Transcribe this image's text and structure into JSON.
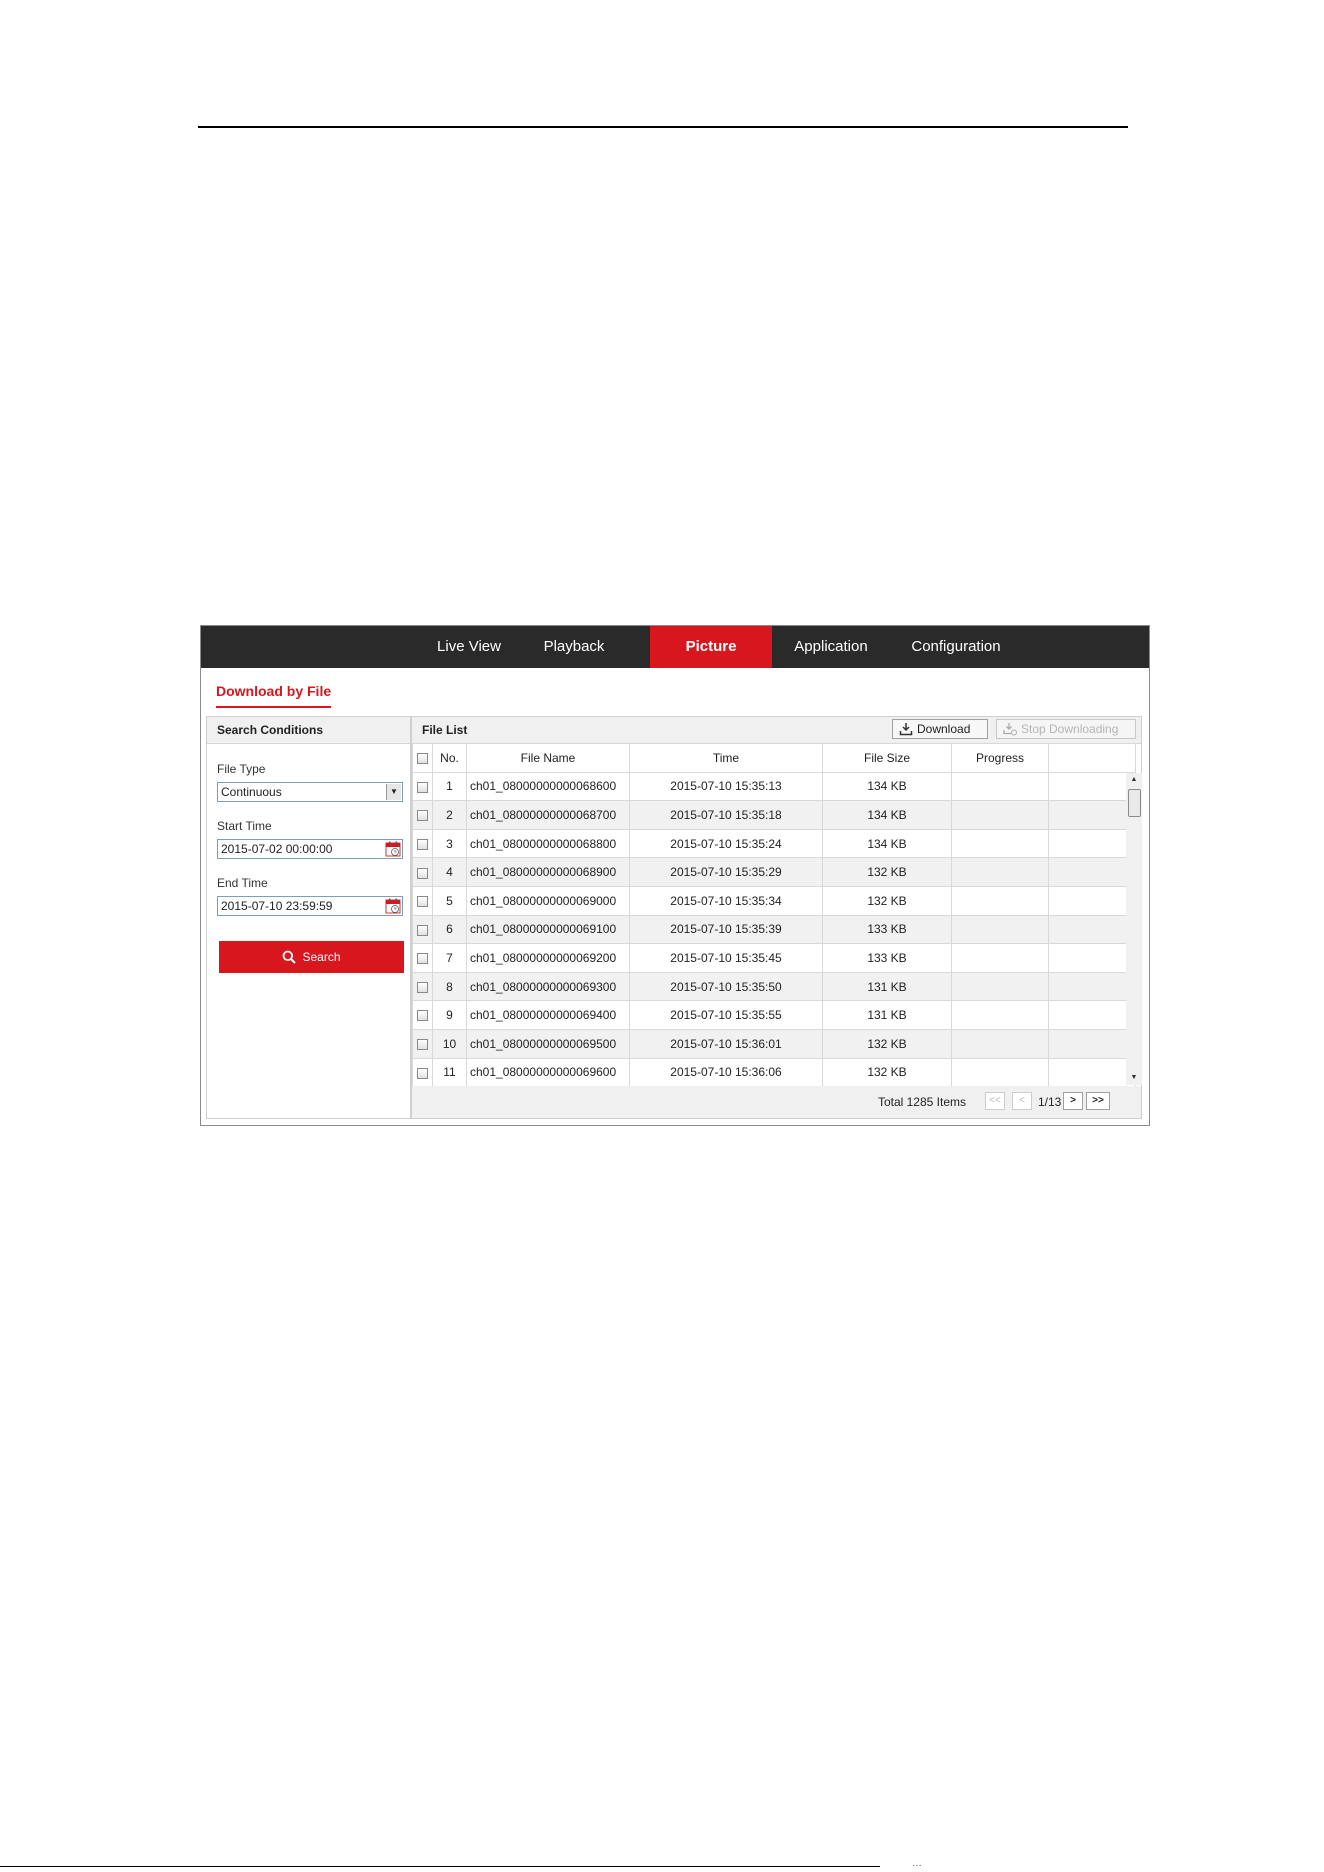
{
  "nav": {
    "tabs": [
      {
        "label": "Live View",
        "active": false
      },
      {
        "label": "Playback",
        "active": false
      },
      {
        "label": "Picture",
        "active": true
      },
      {
        "label": "Application",
        "active": false
      },
      {
        "label": "Configuration",
        "active": false
      }
    ],
    "accent_color": "#d7161e"
  },
  "subtab": {
    "label": "Download by File"
  },
  "search": {
    "title": "Search Conditions",
    "file_type_label": "File Type",
    "file_type_value": "Continuous",
    "start_label": "Start Time",
    "start_value": "2015-07-02 00:00:00",
    "end_label": "End Time",
    "end_value": "2015-07-10 23:59:59",
    "button_label": "Search"
  },
  "file_list": {
    "title": "File List",
    "download_label": "Download",
    "stop_label": "Stop Downloading",
    "columns": [
      "No.",
      "File Name",
      "Time",
      "File Size",
      "Progress"
    ],
    "rows": [
      {
        "no": "1",
        "name": "ch01_08000000000068600",
        "time": "2015-07-10 15:35:13",
        "size": "134 KB",
        "progress": ""
      },
      {
        "no": "2",
        "name": "ch01_08000000000068700",
        "time": "2015-07-10 15:35:18",
        "size": "134 KB",
        "progress": ""
      },
      {
        "no": "3",
        "name": "ch01_08000000000068800",
        "time": "2015-07-10 15:35:24",
        "size": "134 KB",
        "progress": ""
      },
      {
        "no": "4",
        "name": "ch01_08000000000068900",
        "time": "2015-07-10 15:35:29",
        "size": "132 KB",
        "progress": ""
      },
      {
        "no": "5",
        "name": "ch01_08000000000069000",
        "time": "2015-07-10 15:35:34",
        "size": "132 KB",
        "progress": ""
      },
      {
        "no": "6",
        "name": "ch01_08000000000069100",
        "time": "2015-07-10 15:35:39",
        "size": "133 KB",
        "progress": ""
      },
      {
        "no": "7",
        "name": "ch01_08000000000069200",
        "time": "2015-07-10 15:35:45",
        "size": "133 KB",
        "progress": ""
      },
      {
        "no": "8",
        "name": "ch01_08000000000069300",
        "time": "2015-07-10 15:35:50",
        "size": "131 KB",
        "progress": ""
      },
      {
        "no": "9",
        "name": "ch01_08000000000069400",
        "time": "2015-07-10 15:35:55",
        "size": "131 KB",
        "progress": ""
      },
      {
        "no": "10",
        "name": "ch01_08000000000069500",
        "time": "2015-07-10 15:36:01",
        "size": "132 KB",
        "progress": ""
      },
      {
        "no": "11",
        "name": "ch01_08000000000069600",
        "time": "2015-07-10 15:36:06",
        "size": "132 KB",
        "progress": ""
      }
    ]
  },
  "pagination": {
    "total_text": "Total 1285 Items",
    "first": "<<",
    "prev": "<",
    "page_text": "1/13",
    "next": ">",
    "last": ">>"
  },
  "footer_note": "…"
}
